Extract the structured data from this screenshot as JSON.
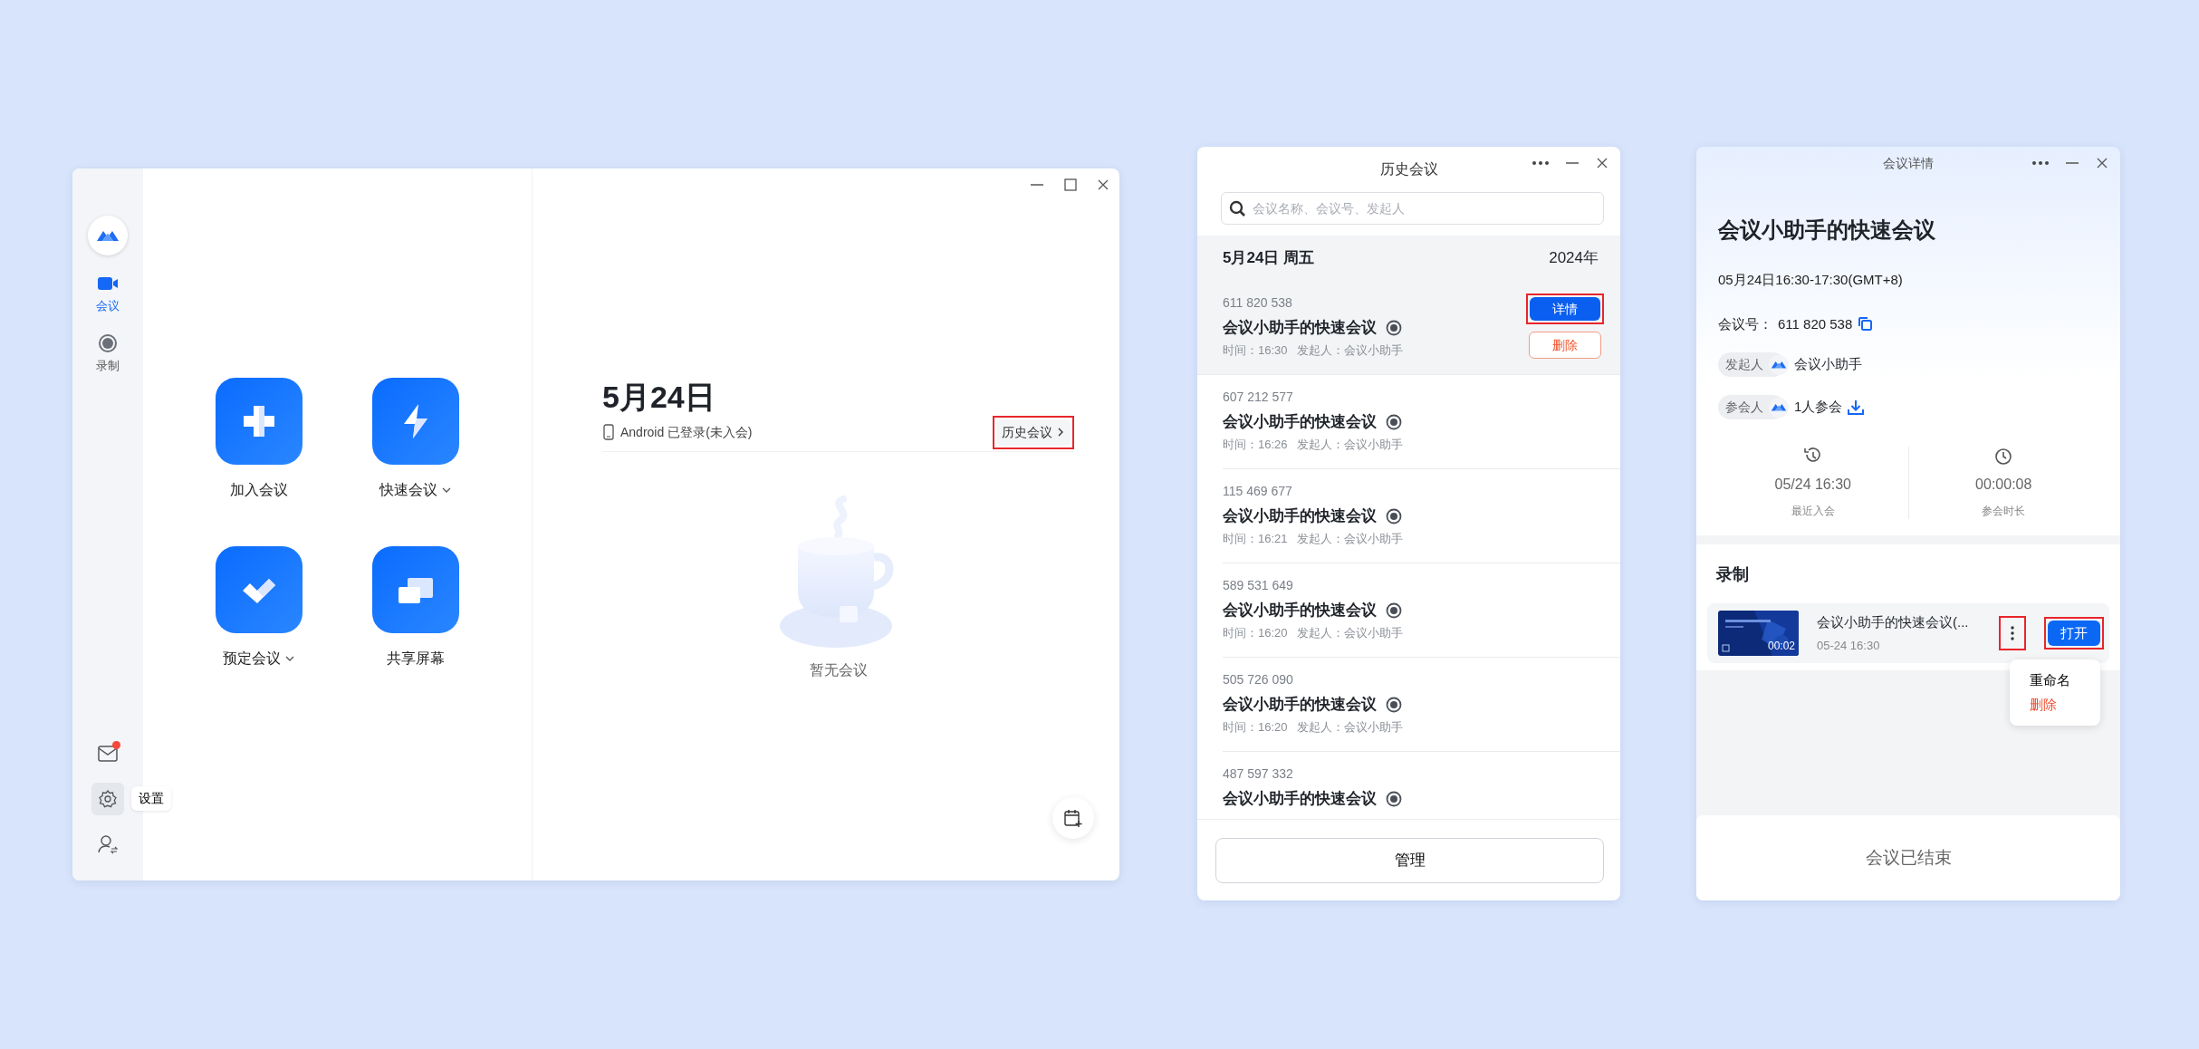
{
  "main_window": {
    "sidebar": {
      "items": [
        {
          "label": "会议",
          "kind": "video",
          "selected": true
        },
        {
          "label": "录制",
          "kind": "record",
          "selected": false
        }
      ],
      "mail_unread": true,
      "settings_tooltip": "设置"
    },
    "actions": [
      {
        "label": "加入会议",
        "kind": "join",
        "dropdown": false
      },
      {
        "label": "快速会议",
        "kind": "quick",
        "dropdown": true
      },
      {
        "label": "预定会议",
        "kind": "schedule",
        "dropdown": true
      },
      {
        "label": "共享屏幕",
        "kind": "share",
        "dropdown": false
      }
    ],
    "date": "5月24日",
    "device_status": "Android 已登录(未入会)",
    "history_link": {
      "label": "历史会议",
      "highlighted": true
    },
    "empty_text": "暂无会议"
  },
  "history_window": {
    "title": "历史会议",
    "search": {
      "placeholder": "会议名称、会议号、发起人"
    },
    "day_header": {
      "date": "5月24日 周五",
      "year": "2024年"
    },
    "row_actions": {
      "detail": {
        "label": "详情",
        "highlighted": true
      },
      "delete": "删除"
    },
    "meetings": [
      {
        "number": "611 820 538",
        "title": "会议小助手的快速会议",
        "time": "时间：16:30",
        "initiator": "发起人：会议小助手",
        "selected": true
      },
      {
        "number": "607 212 577",
        "title": "会议小助手的快速会议",
        "time": "时间：16:26",
        "initiator": "发起人：会议小助手",
        "selected": false
      },
      {
        "number": "115 469 677",
        "title": "会议小助手的快速会议",
        "time": "时间：16:21",
        "initiator": "发起人：会议小助手",
        "selected": false
      },
      {
        "number": "589 531 649",
        "title": "会议小助手的快速会议",
        "time": "时间：16:20",
        "initiator": "发起人：会议小助手",
        "selected": false
      },
      {
        "number": "505 726 090",
        "title": "会议小助手的快速会议",
        "time": "时间：16:20",
        "initiator": "发起人：会议小助手",
        "selected": false
      },
      {
        "number": "487 597 332",
        "title": "会议小助手的快速会议",
        "selected": false
      }
    ],
    "manage_button": "管理"
  },
  "detail_window": {
    "title": "会议详情",
    "meeting_title": "会议小助手的快速会议",
    "time_range": "05月24日16:30-17:30(GMT+8)",
    "number_label": "会议号：",
    "number": "611 820 538",
    "host": {
      "tag": "发起人",
      "name": "会议小助手"
    },
    "participants": {
      "tag": "参会人",
      "text": "1人参会"
    },
    "stats": [
      {
        "kind": "history",
        "value": "05/24 16:30",
        "label": "最近入会"
      },
      {
        "kind": "clock",
        "value": "00:00:08",
        "label": "参会时长"
      }
    ],
    "recording_heading": "录制",
    "recording": {
      "title": "会议小助手的快速会议(...",
      "date": "05-24 16:30",
      "duration": "00:02",
      "more_highlighted": true,
      "open_button": {
        "label": "打开",
        "highlighted": true
      }
    },
    "menu": [
      {
        "label": "重命名",
        "kind": "normal"
      },
      {
        "label": "删除",
        "kind": "danger"
      }
    ],
    "footer": "会议已结束"
  }
}
